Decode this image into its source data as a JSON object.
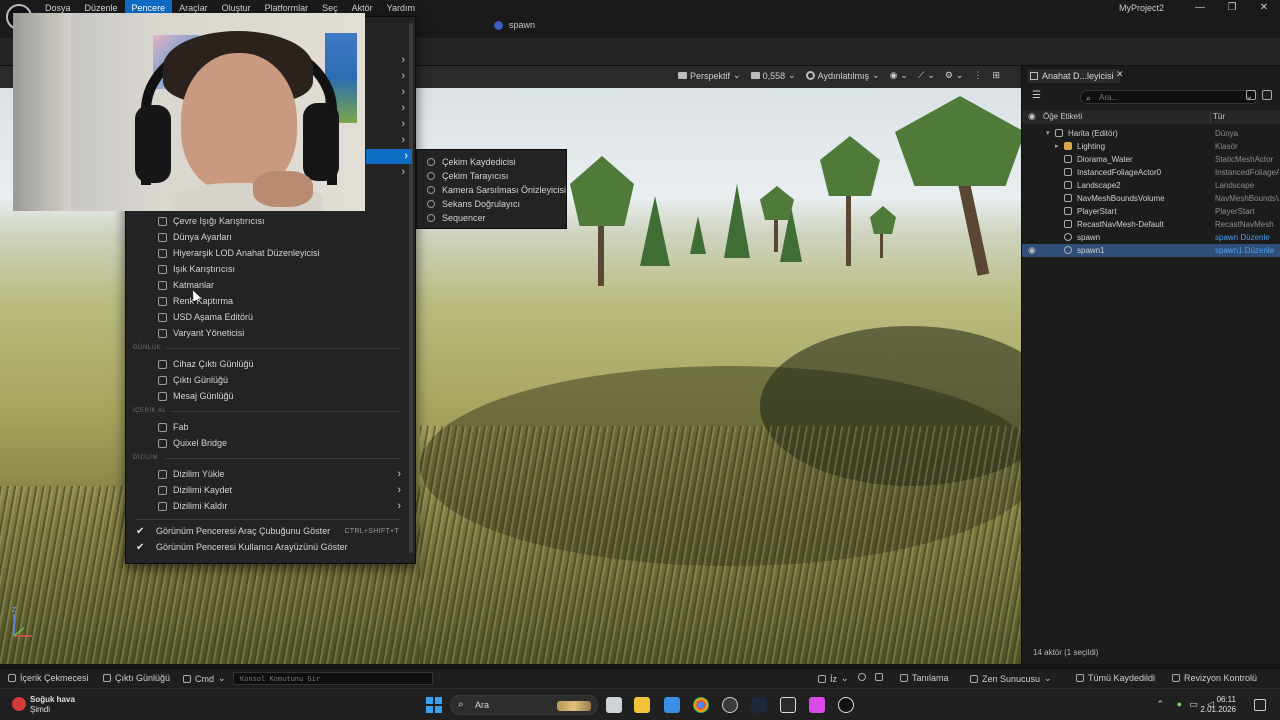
{
  "menubar": {
    "items": [
      "Dosya",
      "Düzenle",
      "Pencere",
      "Araçlar",
      "Oluştur",
      "Platformlar",
      "Seç",
      "Aktör",
      "Yardım"
    ],
    "active": "Pencere",
    "project": "MyProject2",
    "min": "—",
    "max": "❐",
    "close": "✕"
  },
  "tabbar": {
    "level_tab": "spawn"
  },
  "viewport": {
    "perspective": "Perspektif",
    "speed": "0,558",
    "lighting": "Aydınlatılmış",
    "axis_z": "Z"
  },
  "pencere_menu": {
    "items": [
      {
        "label": "Çevre Işığı Karıştırıcısı"
      },
      {
        "label": "Dünya Ayarları"
      },
      {
        "label": "Hiyerarşik LOD Anahat Düzenleyicisi"
      },
      {
        "label": "Işık Karıştırıcısı"
      },
      {
        "label": "Katmanlar"
      },
      {
        "label": "Renk Kaptırma"
      },
      {
        "label": "USD Aşama Editörü"
      },
      {
        "label": "Varyant Yöneticisi"
      }
    ],
    "section_log": "GÜNLÜK",
    "log_items": [
      {
        "label": "Cihaz Çıktı Günlüğü"
      },
      {
        "label": "Çıktı Günlüğü"
      },
      {
        "label": "Mesaj Günlüğü"
      }
    ],
    "section_import": "İÇERİK AL",
    "import_items": [
      {
        "label": "Fab"
      },
      {
        "label": "Quixel Bridge"
      }
    ],
    "section_layout": "DİZİLİM",
    "layout_items": [
      {
        "label": "Dizilim Yükle"
      },
      {
        "label": "Dizilimi Kaydet"
      },
      {
        "label": "Dizilimi Kaldır"
      }
    ],
    "toggles": [
      {
        "label": "Görünüm Penceresi Araç Çubuğunu Göster",
        "shortcut": "CTRL+SHIFT+T"
      },
      {
        "label": "Görünüm Penceresi Kullanıcı Arayüzünü Göster",
        "shortcut": ""
      }
    ]
  },
  "submenu": {
    "items": [
      "Çekim Kaydedicisi",
      "Çekim Tarayıcısı",
      "Kamera Sarsılması Önizleyicisi",
      "Sekans Doğrulayıcı",
      "Sequencer"
    ]
  },
  "outliner": {
    "tab": "Anahat D...leyicisi",
    "search_placeholder": "Ara...",
    "col_label": "Öğe Etiketi",
    "col_type": "Tür",
    "rows": [
      {
        "name": "Harita (Editör)",
        "type": "Dünya"
      },
      {
        "name": "Lighting",
        "type": "Klasör"
      },
      {
        "name": "Diorama_Water",
        "type": "StaticMeshActor"
      },
      {
        "name": "InstancedFoliageActor0",
        "type": "InstancedFoliageActor"
      },
      {
        "name": "Landscape2",
        "type": "Landscape"
      },
      {
        "name": "NavMeshBoundsVolume",
        "type": "NavMeshBoundsVolume"
      },
      {
        "name": "PlayerStart",
        "type": "PlayerStart"
      },
      {
        "name": "RecastNavMesh-Default",
        "type": "RecastNavMesh"
      },
      {
        "name": "spawn",
        "type": "spawn Düzenle"
      },
      {
        "name": "spawn1",
        "type": "spawn1 Düzenle"
      }
    ],
    "footer": "14 aktör (1 seçildi)"
  },
  "statusbar": {
    "content_drawer": "İçerik Çekmecesi",
    "output_log": "Çıktı Günlüğü",
    "cmd": "Cmd",
    "console_placeholder": "Konsol Komutunu Gir",
    "derive": "İz",
    "diagnose": "Tanılama",
    "zen": "Zen Sunucusu",
    "saved": "Tümü Kaydedildi",
    "revision": "Revizyon Kontrolü"
  },
  "taskbar": {
    "weather_title": "Soğuk hava",
    "weather_sub": "Şimdi",
    "search": "Ara",
    "time": "06:11",
    "date": "2.01.2026"
  },
  "colors": {
    "accent": "#0f6cc4",
    "selected_row": "#2f4f78",
    "link": "#4f9ee8"
  }
}
